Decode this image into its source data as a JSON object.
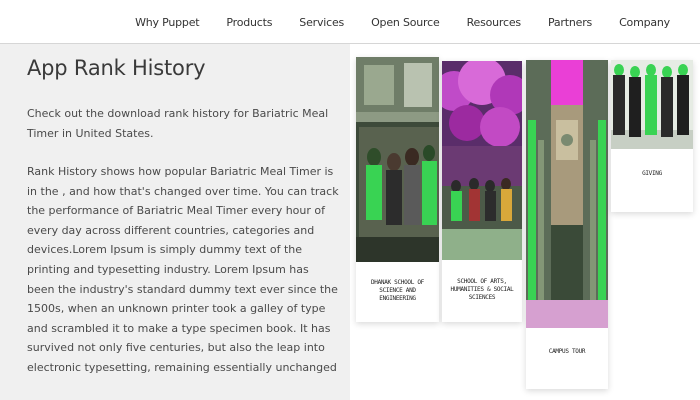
{
  "nav": {
    "items": [
      "Why Puppet",
      "Products",
      "Services",
      "Open Source",
      "Resources",
      "Partners",
      "Company"
    ]
  },
  "page": {
    "title": "App Rank History",
    "intro": "Check out the download rank history for Bariatric Meal Timer in United States.",
    "body": "Rank History shows how popular Bariatric Meal Timer is in the , and how that's changed over time. You can track the performance of Bariatric Meal Timer every hour of every day across different countries, categories and devices.Lorem Ipsum is simply dummy text of the printing and typesetting industry. Lorem Ipsum has been the industry's standard dummy text ever since the 1500s, when an unknown printer took a galley of type and scrambled it to make a type specimen book. It has survived not only five centuries, but also the leap into electronic typesetting, remaining essentially unchanged"
  },
  "gallery": {
    "cards": [
      {
        "caption": "DHANAK SCHOOL OF SCIENCE AND ENGINEERING"
      },
      {
        "caption": "SCHOOL OF ARTS, HUMANITIES & SOCIAL SCIENCES"
      },
      {
        "caption": "CAMPUS TOUR"
      },
      {
        "caption": "GIVING"
      }
    ]
  },
  "colors": {
    "left_panel_bg": "#f0f0f0",
    "photo_green": "#39d353",
    "photo_magenta": "#d63cd6"
  }
}
